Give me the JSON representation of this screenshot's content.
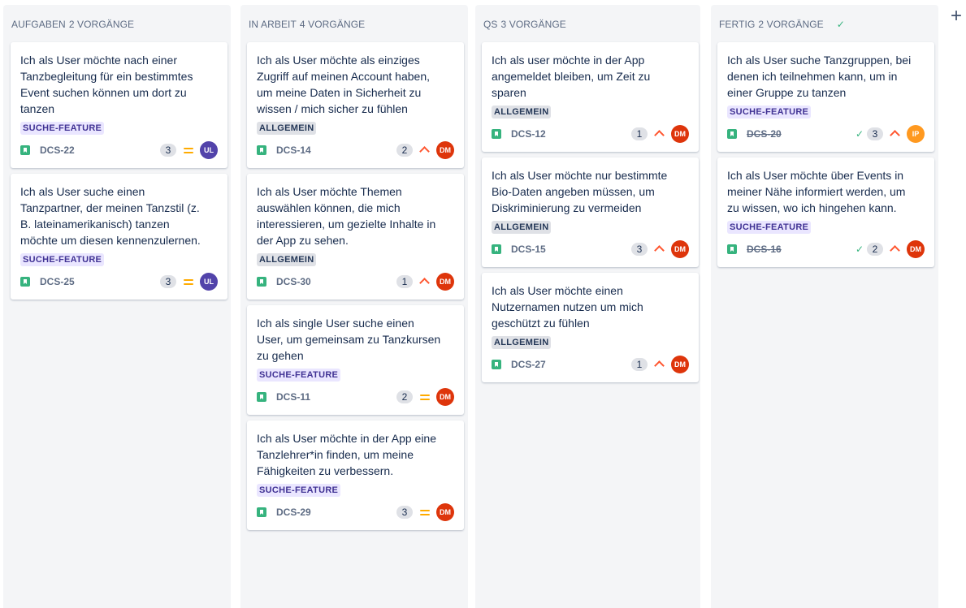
{
  "colors": {
    "purple_avatar": "#5243aa",
    "red_avatar": "#de350b",
    "orange_avatar": "#ff991f",
    "story": "#36b37e"
  },
  "columns": [
    {
      "name": "AUFGABEN",
      "count": "2 VORGÄNGE",
      "cards": [
        {
          "title": "Ich als User möchte nach einer Tanzbegleitung für ein bestimmtes Event suchen können um dort zu tanzen",
          "label": "SUCHE-FEATURE",
          "key": "DCS-22",
          "points": "3",
          "priority": "medium-icon",
          "avatar": "UL"
        },
        {
          "title": "Ich als User suche einen Tanzpartner, der meinen Tanzstil (z. B. lateinamerikanisch) tanzen möchte um diesen kennenzulernen.",
          "label": "SUCHE-FEATURE",
          "key": "DCS-25",
          "points": "3",
          "priority": "medium-icon",
          "avatar": "UL"
        }
      ]
    },
    {
      "name": "IN ARBEIT",
      "count": "4 VORGÄNGE",
      "cards": [
        {
          "title": "Ich als User möchte als einziges Zugriff auf meinen Account haben, um meine Daten in Sicherheit zu wissen / mich sicher zu fühlen",
          "label": "ALLGEMEIN",
          "key": "DCS-14",
          "points": "2",
          "priority": "high-icon",
          "avatar": "DM"
        },
        {
          "title": "Ich als User möchte Themen auswählen können, die mich interessieren, um gezielte Inhalte in der App zu sehen.",
          "label": "ALLGEMEIN",
          "key": "DCS-30",
          "points": "1",
          "priority": "high-icon",
          "avatar": "DM"
        },
        {
          "title": "Ich als single User suche einen User, um gemeinsam zu Tanzkursen zu gehen",
          "label": "SUCHE-FEATURE",
          "key": "DCS-11",
          "points": "2",
          "priority": "medium-icon",
          "avatar": "DM"
        },
        {
          "title": "Ich als User möchte in der App eine Tanzlehrer*in finden, um meine Fähigkeiten zu verbessern.",
          "label": "SUCHE-FEATURE",
          "key": "DCS-29",
          "points": "3",
          "priority": "medium-icon",
          "avatar": "DM"
        }
      ]
    },
    {
      "name": "QS",
      "count": "3 VORGÄNGE",
      "cards": [
        {
          "title": "Ich als user möchte in der App angemeldet bleiben, um Zeit zu sparen",
          "label": "ALLGEMEIN",
          "key": "DCS-12",
          "points": "1",
          "priority": "high-icon",
          "avatar": "DM"
        },
        {
          "title": "Ich als User möchte nur bestimmte Bio-Daten angeben müssen, um Diskriminierung zu vermeiden",
          "label": "ALLGEMEIN",
          "key": "DCS-15",
          "points": "3",
          "priority": "high-icon",
          "avatar": "DM"
        },
        {
          "title": "Ich als User möchte einen Nutzernamen nutzen um mich geschützt zu fühlen",
          "label": "ALLGEMEIN",
          "key": "DCS-27",
          "points": "1",
          "priority": "high-icon",
          "avatar": "DM"
        }
      ]
    },
    {
      "name": "FERTIG",
      "count": "2 VORGÄNGE",
      "cards": [
        {
          "title": "Ich als User suche Tanzgruppen, bei denen ich teilnehmen kann, um in einer Gruppe zu tanzen",
          "label": "SUCHE-FEATURE",
          "key": "DCS-20",
          "points": "3",
          "priority": "high-icon",
          "avatar": "IP"
        },
        {
          "title": "Ich als User möchte über Events in meiner Nähe informiert werden, um zu wissen, wo ich hingehen kann.",
          "label": "SUCHE-FEATURE",
          "key": "DCS-16",
          "points": "2",
          "priority": "high-icon",
          "avatar": "DM"
        }
      ]
    }
  ],
  "add_column": "+"
}
